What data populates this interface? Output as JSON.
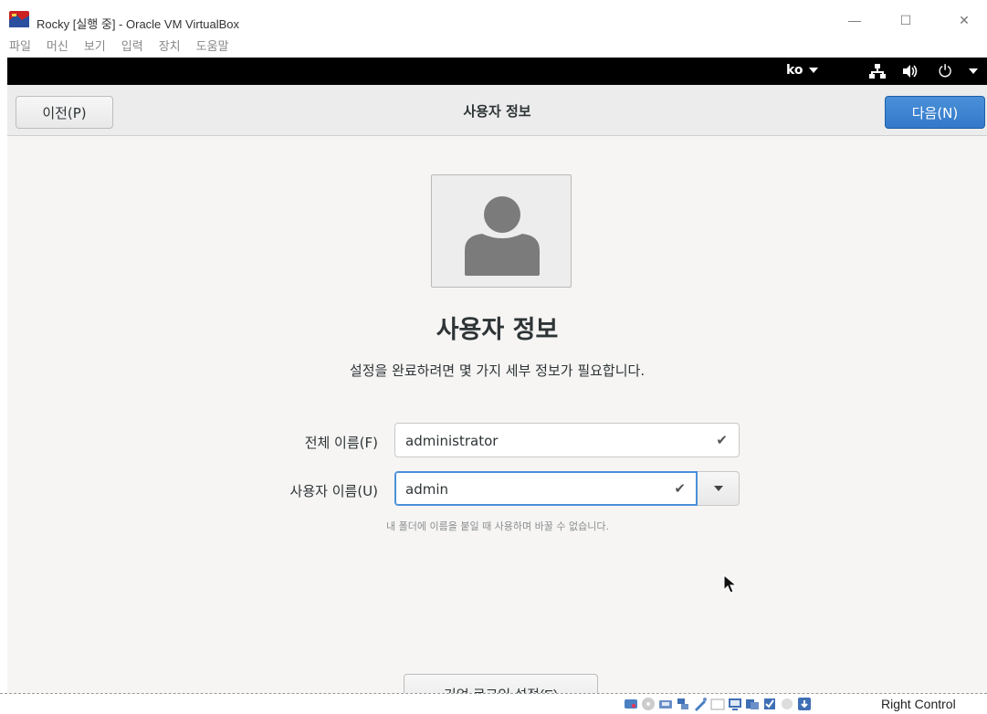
{
  "window": {
    "title": "Rocky [실행 중] - Oracle VM VirtualBox",
    "minimize": "—",
    "maximize": "☐",
    "close": "✕"
  },
  "menubar": {
    "items": [
      "파일",
      "머신",
      "보기",
      "입력",
      "장치",
      "도움말"
    ]
  },
  "topbar": {
    "language": "ko",
    "icons": [
      "network-icon",
      "volume-icon",
      "power-icon"
    ]
  },
  "header": {
    "prev_label": "이전(P)",
    "title": "사용자 정보",
    "next_label": "다음(N)"
  },
  "main": {
    "title": "사용자 정보",
    "subtitle": "설정을 완료하려면 몇 가지 세부 정보가 필요합니다.",
    "full_name_label": "전체 이름(F)",
    "full_name_value": "administrator",
    "username_label": "사용자 이름(U)",
    "username_value": "admin",
    "username_hint": "내 폴더에 이름을 붙일 때 사용하며 바꿀 수 없습니다.",
    "enterprise_login_label": "기업 로그인 설정(E)"
  },
  "statusbar": {
    "host_key": "Right Control"
  },
  "colors": {
    "accent": "#4a90d9",
    "topbar": "#000000",
    "header": "#ececec",
    "content": "#f6f5f4"
  }
}
